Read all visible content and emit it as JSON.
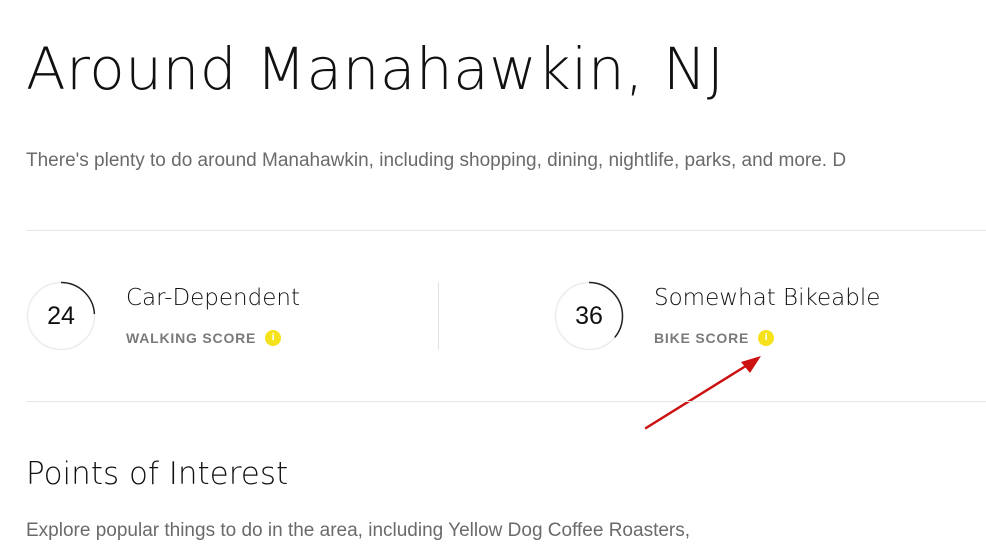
{
  "page": {
    "title": "Around Manahawkin, NJ",
    "intro": "There's plenty to do around Manahawkin, including shopping, dining, nightlife, parks, and more. D"
  },
  "scores": {
    "walking": {
      "value": "24",
      "label": "Car-Dependent",
      "type": "WALKING SCORE",
      "fraction": 0.24,
      "info_icon": "info-icon"
    },
    "bike": {
      "value": "36",
      "label": "Somewhat Bikeable",
      "type": "BIKE SCORE",
      "fraction": 0.36,
      "info_icon": "info-icon"
    }
  },
  "points_of_interest": {
    "heading": "Points of Interest",
    "text": "Explore popular things to do in the area, including Yellow Dog Coffee Roasters,"
  },
  "colors": {
    "info_icon": "#f5e21b",
    "gauge_track": "#ececec",
    "gauge_arc": "#222222",
    "annotation_arrow": "#cc1111"
  }
}
